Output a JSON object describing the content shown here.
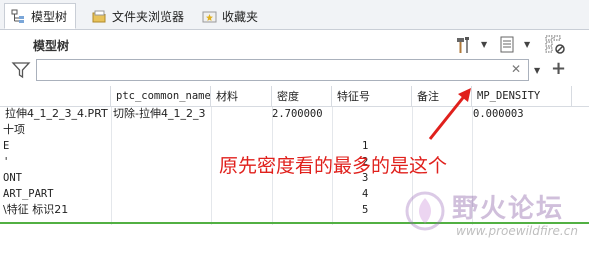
{
  "tabs": [
    {
      "label": "模型树",
      "icon": "model-tree-icon",
      "active": true
    },
    {
      "label": "文件夹浏览器",
      "icon": "folder-browser-icon",
      "active": false
    },
    {
      "label": "收藏夹",
      "icon": "favorites-icon",
      "active": false
    }
  ],
  "panel": {
    "title": "模型树",
    "tools": [
      "hammer-icon",
      "list-settings-icon",
      "tree-columns-icon"
    ]
  },
  "filter": {
    "value": "",
    "clear_symbol": "✕",
    "dropdown_symbol": "▼",
    "add_symbol": "+"
  },
  "table": {
    "columns": [
      "",
      "ptc_common_name",
      "材料",
      "密度",
      "特征号",
      "备注",
      "MP_DENSITY"
    ],
    "rows": [
      {
        "name": "拉伸4_1_2_3_4.PRT",
        "common": "切除-拉伸4_1_2_3",
        "material": "",
        "density": "2.700000",
        "feature_no": "",
        "note": "",
        "mp_density": "0.000003"
      },
      {
        "name": "十项",
        "common": "",
        "material": "",
        "density": "",
        "feature_no": "",
        "note": "",
        "mp_density": ""
      },
      {
        "name": "E",
        "common": "",
        "material": "",
        "density": "",
        "feature_no": "1",
        "note": "",
        "mp_density": ""
      },
      {
        "name": "'",
        "common": "",
        "material": "",
        "density": "",
        "feature_no": "2",
        "note": "",
        "mp_density": ""
      },
      {
        "name": "ONT",
        "common": "",
        "material": "",
        "density": "",
        "feature_no": "3",
        "note": "",
        "mp_density": ""
      },
      {
        "name": "ART_PART",
        "common": "",
        "material": "",
        "density": "",
        "feature_no": "4",
        "note": "",
        "mp_density": ""
      },
      {
        "name": "\\特征 标识21",
        "common": "",
        "material": "",
        "density": "",
        "feature_no": "5",
        "note": "",
        "mp_density": ""
      }
    ]
  },
  "annotation": {
    "text": "原先密度看的最多的是这个",
    "color": "#e0201c"
  },
  "watermark": {
    "text": "野火论坛",
    "url": "www.proewildfire.cn"
  },
  "colors": {
    "accent_green": "#52b043",
    "annotation_red": "#e0201c",
    "tab_bg": "#f1f3f6"
  }
}
